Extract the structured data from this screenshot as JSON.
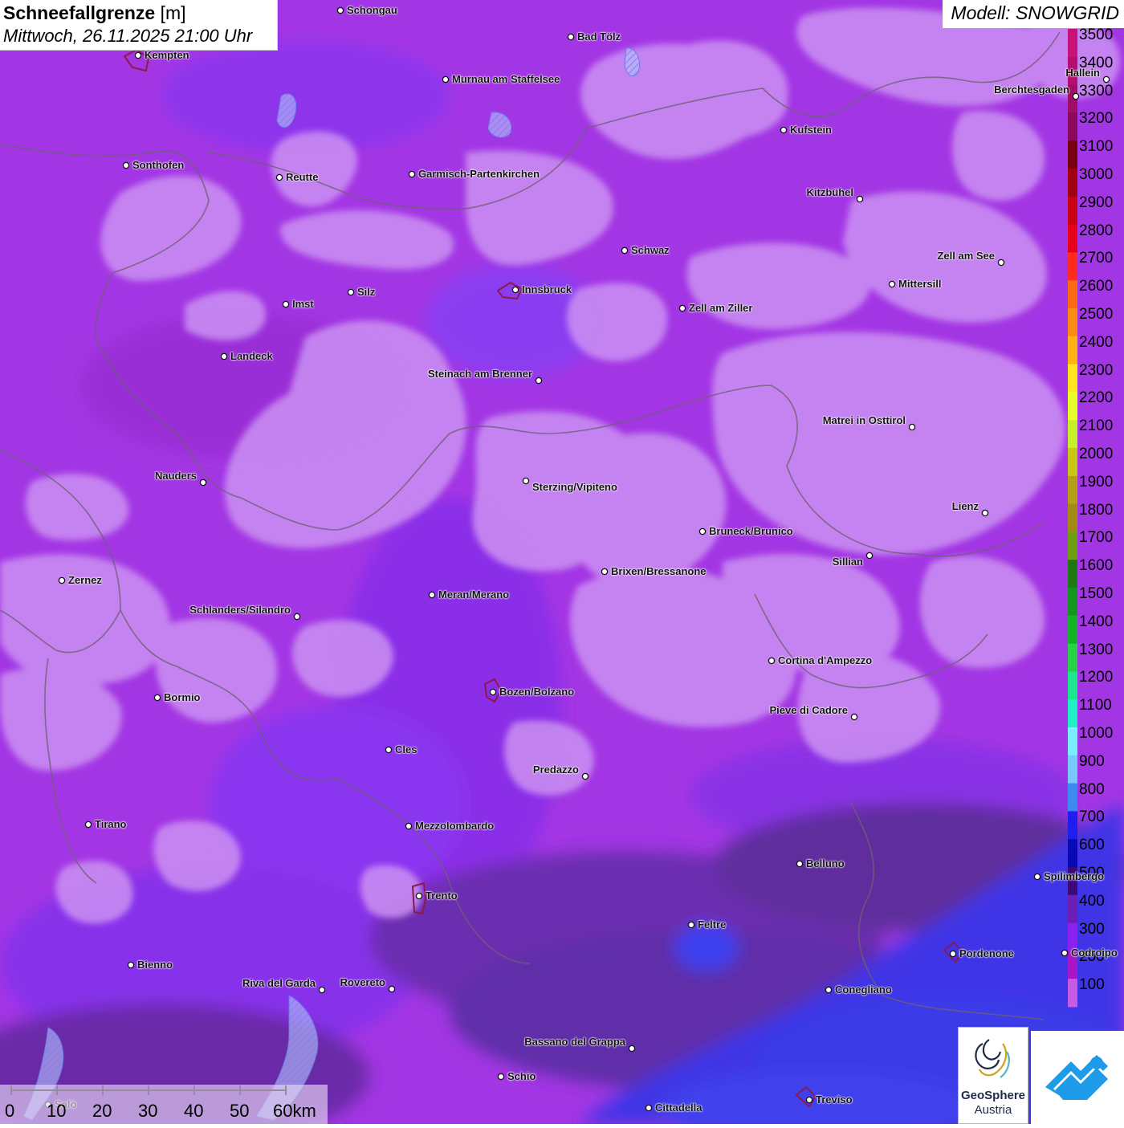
{
  "header": {
    "title": "Schneefallgrenze",
    "unit": "[m]",
    "datetime": "Mittwoch, 26.11.2025 21:00 Uhr",
    "model": "Modell: SNOWGRID"
  },
  "legend": {
    "levels": [
      {
        "value": "3500",
        "color": "#c8127a"
      },
      {
        "value": "3400",
        "color": "#b40f70"
      },
      {
        "value": "3300",
        "color": "#a00c66"
      },
      {
        "value": "3200",
        "color": "#8c0a5c"
      },
      {
        "value": "3100",
        "color": "#780010"
      },
      {
        "value": "3000",
        "color": "#a00010"
      },
      {
        "value": "2900",
        "color": "#c80014"
      },
      {
        "value": "2800",
        "color": "#e6001c"
      },
      {
        "value": "2700",
        "color": "#ff2a1e"
      },
      {
        "value": "2600",
        "color": "#ff6a14"
      },
      {
        "value": "2500",
        "color": "#ff8c14"
      },
      {
        "value": "2400",
        "color": "#ffb414"
      },
      {
        "value": "2300",
        "color": "#ffe61e"
      },
      {
        "value": "2200",
        "color": "#e6ff28"
      },
      {
        "value": "2100",
        "color": "#c8f028"
      },
      {
        "value": "2000",
        "color": "#c8c814"
      },
      {
        "value": "1900",
        "color": "#b4a014"
      },
      {
        "value": "1800",
        "color": "#a08c14"
      },
      {
        "value": "1700",
        "color": "#6ea014"
      },
      {
        "value": "1600",
        "color": "#1e7814"
      },
      {
        "value": "1500",
        "color": "#14961e"
      },
      {
        "value": "1400",
        "color": "#14b428"
      },
      {
        "value": "1300",
        "color": "#28d246"
      },
      {
        "value": "1200",
        "color": "#1ee68c"
      },
      {
        "value": "1100",
        "color": "#1ef0c8"
      },
      {
        "value": "1000",
        "color": "#78f0ff"
      },
      {
        "value": "900",
        "color": "#78c8ff"
      },
      {
        "value": "800",
        "color": "#3c8cf0"
      },
      {
        "value": "700",
        "color": "#1e1ef0"
      },
      {
        "value": "600",
        "color": "#0a0ab4"
      },
      {
        "value": "500",
        "color": "#3c0a78"
      },
      {
        "value": "400",
        "color": "#6e1eb4"
      },
      {
        "value": "300",
        "color": "#8c1ef0"
      },
      {
        "value": "200",
        "color": "#a814c8"
      },
      {
        "value": "100",
        "color": "#c85ae6"
      }
    ]
  },
  "cities": [
    {
      "name": "Schongau"
    },
    {
      "name": "Kempten"
    },
    {
      "name": "Bad Tölz"
    },
    {
      "name": "Murnau am Staffelsee"
    },
    {
      "name": "Hallein"
    },
    {
      "name": "Berchtesgaden"
    },
    {
      "name": "Kufstein"
    },
    {
      "name": "Sonthofen"
    },
    {
      "name": "Reutte"
    },
    {
      "name": "Garmisch-Partenkirchen"
    },
    {
      "name": "Kitzbühel"
    },
    {
      "name": "Schwaz"
    },
    {
      "name": "Zell am See"
    },
    {
      "name": "Innsbruck"
    },
    {
      "name": "Mittersill"
    },
    {
      "name": "Silz"
    },
    {
      "name": "Imst"
    },
    {
      "name": "Zell am Ziller"
    },
    {
      "name": "Landeck"
    },
    {
      "name": "Steinach am Brenner"
    },
    {
      "name": "Matrei in Osttirol"
    },
    {
      "name": "Nauders"
    },
    {
      "name": "Sterzing/Vipiteno"
    },
    {
      "name": "Lienz"
    },
    {
      "name": "Bruneck/Brunico"
    },
    {
      "name": "Sillian"
    },
    {
      "name": "Zernez"
    },
    {
      "name": "Brixen/Bressanone"
    },
    {
      "name": "Meran/Merano"
    },
    {
      "name": "Schlanders/Silandro"
    },
    {
      "name": "Cortina d'Ampezzo"
    },
    {
      "name": "Bormio"
    },
    {
      "name": "Bozen/Bolzano"
    },
    {
      "name": "Pieve di Cadore"
    },
    {
      "name": "Cles"
    },
    {
      "name": "Predazzo"
    },
    {
      "name": "Tirano"
    },
    {
      "name": "Mezzolombardo"
    },
    {
      "name": "Belluno"
    },
    {
      "name": "Spilimbergo"
    },
    {
      "name": "Trento"
    },
    {
      "name": "Feltre"
    },
    {
      "name": "Pordenone"
    },
    {
      "name": "Codroipo"
    },
    {
      "name": "Bienno"
    },
    {
      "name": "Riva del Garda"
    },
    {
      "name": "Rovereto"
    },
    {
      "name": "Conegliano"
    },
    {
      "name": "Bassano del Grappa"
    },
    {
      "name": "Schio"
    },
    {
      "name": "Treviso"
    },
    {
      "name": "Cittadella"
    },
    {
      "name": "Salò"
    }
  ],
  "scale": {
    "ticks": [
      "0",
      "10",
      "20",
      "30",
      "40",
      "50",
      "60km"
    ]
  },
  "logo": {
    "name": "GeoSphere",
    "country": "Austria"
  }
}
